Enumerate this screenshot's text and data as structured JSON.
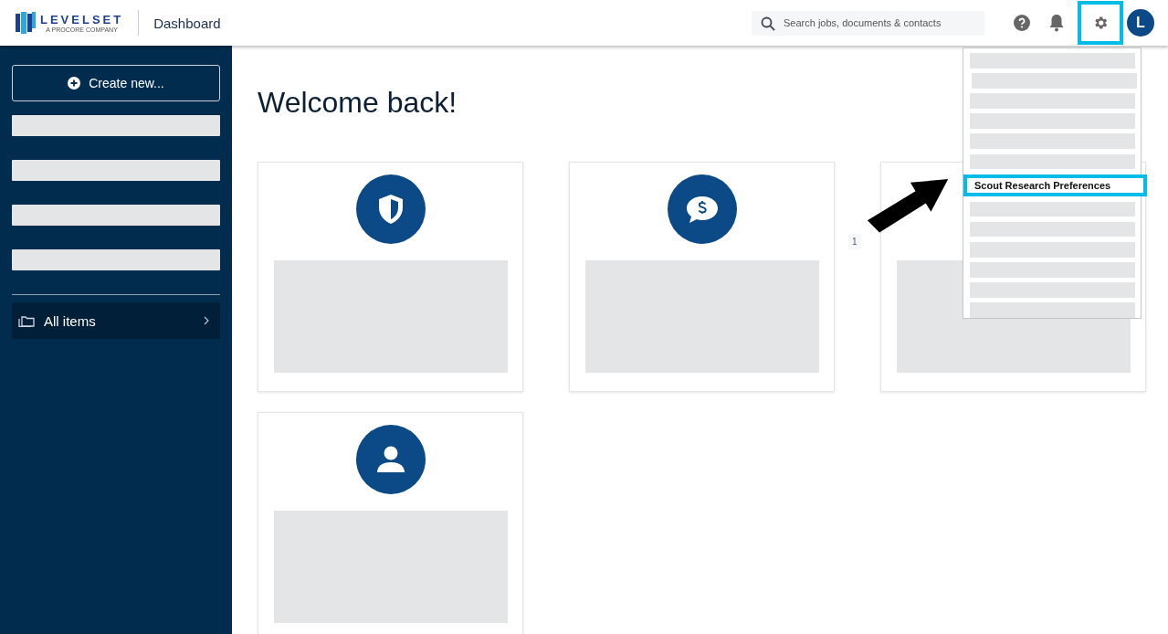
{
  "header": {
    "brand": "LEVELSET",
    "brand_tagline": "A PROCORE COMPANY",
    "page_title": "Dashboard",
    "search": {
      "placeholder": "Search jobs, documents & contacts"
    },
    "settings": {
      "highlighted": true,
      "expanded": true
    },
    "avatar": "L"
  },
  "sidebar": {
    "create_button": "Create new...",
    "items": [
      {
        "kind": "placeholder"
      },
      {
        "kind": "placeholder"
      },
      {
        "kind": "placeholder"
      },
      {
        "kind": "placeholder"
      },
      {
        "kind": "divider"
      },
      {
        "kind": "link",
        "label": "All items"
      }
    ]
  },
  "main": {
    "title": "Welcome back!",
    "badge": "1",
    "cards": [
      {
        "kind": "shield"
      },
      {
        "kind": "money"
      },
      {
        "kind": "plain"
      },
      {
        "kind": "person"
      }
    ]
  },
  "settings_menu": [
    {
      "kind": "placeholder"
    },
    {
      "kind": "placeholder"
    },
    {
      "kind": "placeholder"
    },
    {
      "kind": "placeholder"
    },
    {
      "kind": "placeholder"
    },
    {
      "kind": "placeholder"
    },
    {
      "kind": "item",
      "label": "Scout Research Preferences",
      "highlighted": true
    },
    {
      "kind": "placeholder"
    },
    {
      "kind": "placeholder"
    },
    {
      "kind": "placeholder"
    },
    {
      "kind": "placeholder"
    },
    {
      "kind": "placeholder"
    },
    {
      "kind": "placeholder"
    }
  ],
  "annotation": {
    "arrow": true
  }
}
